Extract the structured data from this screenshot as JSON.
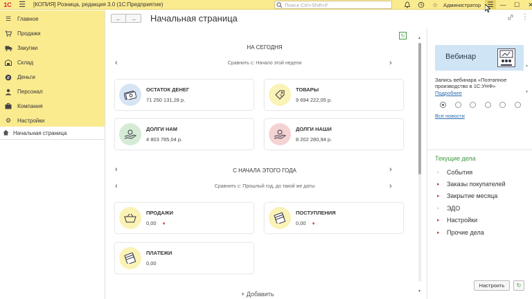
{
  "titlebar": {
    "logo": "1С",
    "title": "[КОПИЯ] Розница, редакция 3.0  (1С:Предприятие)",
    "search_placeholder": "Поиск Ctrl+Shift+F",
    "user": "Администратор"
  },
  "sidebar": {
    "items": [
      {
        "label": "Главное",
        "icon": "menu-icon"
      },
      {
        "label": "Продажи",
        "icon": "cart-icon"
      },
      {
        "label": "Закупки",
        "icon": "truck-icon"
      },
      {
        "label": "Склад",
        "icon": "warehouse-icon"
      },
      {
        "label": "Деньги",
        "icon": "coin-icon"
      },
      {
        "label": "Персонал",
        "icon": "person-icon"
      },
      {
        "label": "Компания",
        "icon": "company-icon"
      },
      {
        "label": "Настройки",
        "icon": "gear-icon"
      }
    ],
    "current": "Начальная страница"
  },
  "page": {
    "title": "Начальная страница"
  },
  "today": {
    "title": "НА СЕГОДНЯ",
    "compare": "Сравнить с: Начало этой недели",
    "cards": [
      {
        "label": "ОСТАТОК ДЕНЕГ",
        "value": "71 250 131,28 р.",
        "icon": "money-icon",
        "color": "#d6e4f3"
      },
      {
        "label": "ТОВАРЫ",
        "value": "9 694 222,05 р.",
        "icon": "tag-icon",
        "color": "#fbf2b5"
      },
      {
        "label": "ДОЛГИ НАМ",
        "value": "4 803 785,04 р.",
        "icon": "hand-give-icon",
        "color": "#d5ebd5"
      },
      {
        "label": "ДОЛГИ НАШИ",
        "value": "8 202 280,94 р.",
        "icon": "hand-take-icon",
        "color": "#f4d3d3"
      }
    ]
  },
  "year": {
    "title": "С НАЧАЛА ЭТОГО ГОДА",
    "compare": "Сравнить с: Прошлый год, до такой же даты",
    "cards": [
      {
        "label": "ПРОДАЖИ",
        "value": "0,00",
        "icon": "basket-icon",
        "color": "#fbf2b5",
        "down": true
      },
      {
        "label": "ПОСТУПЛЕНИЯ",
        "value": "0,00",
        "icon": "cash-stack-icon",
        "color": "#fbf2b5",
        "down": true
      },
      {
        "label": "ПЛАТЕЖИ",
        "value": "0,00",
        "icon": "cash-out-icon",
        "color": "#fbf2b5",
        "down": false
      }
    ]
  },
  "add_label": "+ Добавить",
  "right": {
    "webinar_title": "Вебинар",
    "news_text": "Запись вебинара «Поэтапное производство в 1С:УНФ»",
    "more_link": "Подробнее",
    "all_news": "Все новости",
    "tasks_title": "Текущие дела",
    "tasks": [
      {
        "label": "События",
        "style": "grey"
      },
      {
        "label": "Заказы покупателей",
        "style": "red"
      },
      {
        "label": "Закрытие месяца",
        "style": "red"
      },
      {
        "label": "ЭДО",
        "style": "grey"
      },
      {
        "label": "Настройки",
        "style": "red"
      },
      {
        "label": "Прочие дела",
        "style": "red"
      }
    ],
    "setup_btn": "Настроить"
  },
  "colors": {
    "accent": "#fbeb8f",
    "tasks_green": "#3e9a3e",
    "link_blue": "#2a6db0"
  }
}
